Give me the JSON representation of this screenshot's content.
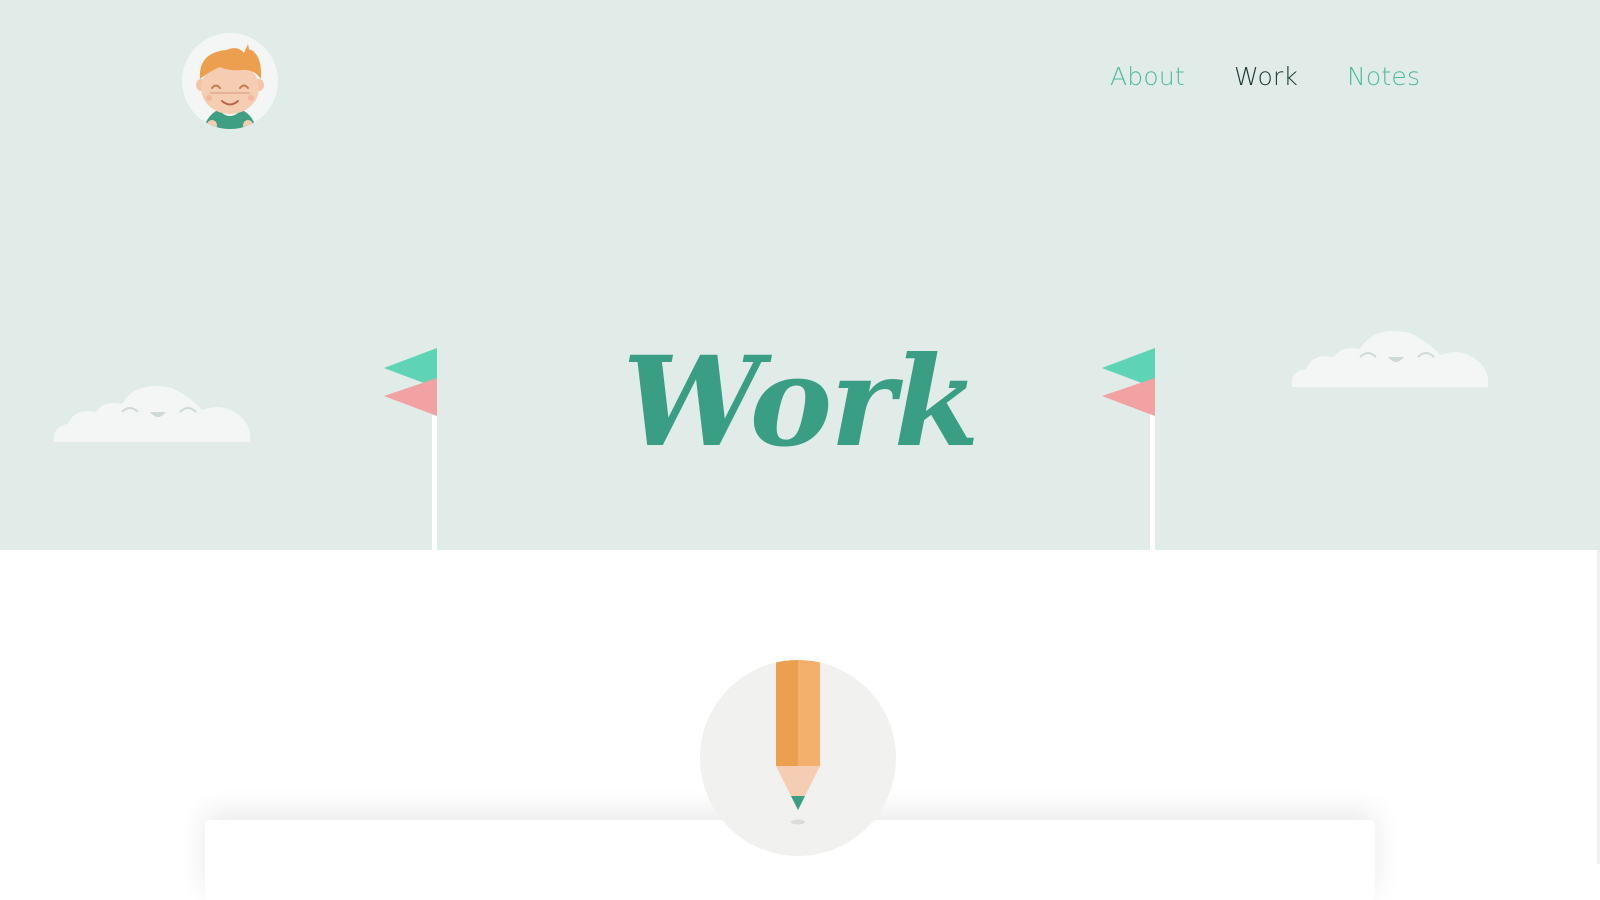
{
  "header": {
    "avatar": {
      "icon": "boy-avatar-icon"
    }
  },
  "nav": {
    "items": [
      {
        "label": "About",
        "active": false
      },
      {
        "label": "Work",
        "active": true
      },
      {
        "label": "Notes",
        "active": false
      }
    ]
  },
  "hero": {
    "title": "Work",
    "decorations": [
      "cloud-icon",
      "flag-icon",
      "flag-icon",
      "cloud-icon"
    ]
  },
  "section": {
    "icon": "pencil-icon"
  },
  "colors": {
    "hero_background": "#e1ebe8",
    "accent_green": "#4dbb9f",
    "title_green": "#3a9e84",
    "active_nav": "#1d3a36",
    "flag_teal": "#5fd4b4",
    "flag_pink": "#f2a2a3",
    "pencil_orange": "#eca04f",
    "cloud": "#f4f6f5"
  }
}
